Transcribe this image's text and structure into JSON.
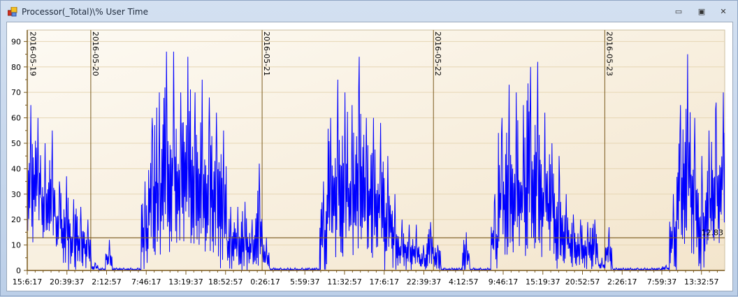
{
  "window": {
    "title": "Processor(_Total)\\% User Time",
    "minimize_icon": "minimize-icon",
    "maximize_icon": "maximize-icon",
    "close_icon": "close-icon",
    "minimize_glyph": "▭",
    "maximize_glyph": "▣",
    "close_glyph": "✕"
  },
  "chart_data": {
    "type": "line",
    "title": "Processor(_Total)\\% User Time",
    "series_color": "#0000ff",
    "axis_color": "#7a5a1e",
    "ylim": [
      0,
      94.5
    ],
    "y_ticks": [
      0,
      10,
      20,
      30,
      40,
      50,
      60,
      70,
      80,
      90
    ],
    "x_range_hours": [
      0,
      97.7
    ],
    "x_tick_interval_hours": 5.5556,
    "x_tick_labels": [
      "15:6:17",
      "20:39:37",
      "2:12:57",
      "7:46:17",
      "13:19:37",
      "18:52:57",
      "0:26:17",
      "5:59:37",
      "11:32:57",
      "17:6:17",
      "22:39:37",
      "4:12:57",
      "9:46:17",
      "15:19:37",
      "20:52:57",
      "2:26:17",
      "7:59:37",
      "13:32:57"
    ],
    "date_markers": [
      {
        "label": "2016-05-19",
        "hour_offset": 0.15
      },
      {
        "label": "2016-05-20",
        "hour_offset": 8.9
      },
      {
        "label": "2016-05-21",
        "hour_offset": 32.9
      },
      {
        "label": "2016-05-22",
        "hour_offset": 56.9
      },
      {
        "label": "2016-05-23",
        "hour_offset": 80.9
      }
    ],
    "reference_line": {
      "value": 12.83,
      "label": "12.83"
    },
    "hourly_max": [
      65,
      60,
      50,
      55,
      35,
      37,
      28,
      25,
      20,
      3,
      1,
      12,
      1,
      1,
      1,
      1,
      35,
      60,
      70,
      86,
      86,
      70,
      84,
      70,
      75,
      68,
      62,
      55,
      25,
      25,
      27,
      20,
      42,
      13,
      1,
      1,
      1,
      1,
      1,
      1,
      1,
      35,
      60,
      75,
      70,
      65,
      84,
      60,
      60,
      58,
      45,
      30,
      20,
      18,
      18,
      10,
      19,
      10,
      1,
      1,
      1,
      15,
      1,
      1,
      1,
      30,
      60,
      73,
      70,
      65,
      80,
      82,
      62,
      50,
      45,
      30,
      22,
      20,
      19,
      20,
      5,
      17,
      1,
      1,
      1,
      1,
      1,
      1,
      1,
      2,
      30,
      65,
      85,
      60,
      45,
      55,
      66,
      70
    ],
    "hourly_min": [
      10,
      15,
      10,
      8,
      8,
      0,
      0,
      0,
      0,
      0,
      0,
      0,
      0,
      0,
      0,
      0,
      0,
      5,
      5,
      5,
      10,
      5,
      5,
      5,
      5,
      5,
      5,
      0,
      0,
      0,
      0,
      0,
      0,
      0,
      0,
      0,
      0,
      0,
      0,
      0,
      0,
      0,
      5,
      5,
      5,
      5,
      5,
      5,
      5,
      5,
      0,
      0,
      0,
      0,
      0,
      0,
      0,
      0,
      0,
      0,
      0,
      0,
      0,
      0,
      0,
      0,
      5,
      5,
      5,
      5,
      5,
      5,
      5,
      5,
      0,
      0,
      0,
      0,
      0,
      0,
      0,
      0,
      0,
      0,
      0,
      0,
      0,
      0,
      0,
      0,
      0,
      10,
      5,
      5,
      0,
      5,
      10,
      15
    ]
  }
}
